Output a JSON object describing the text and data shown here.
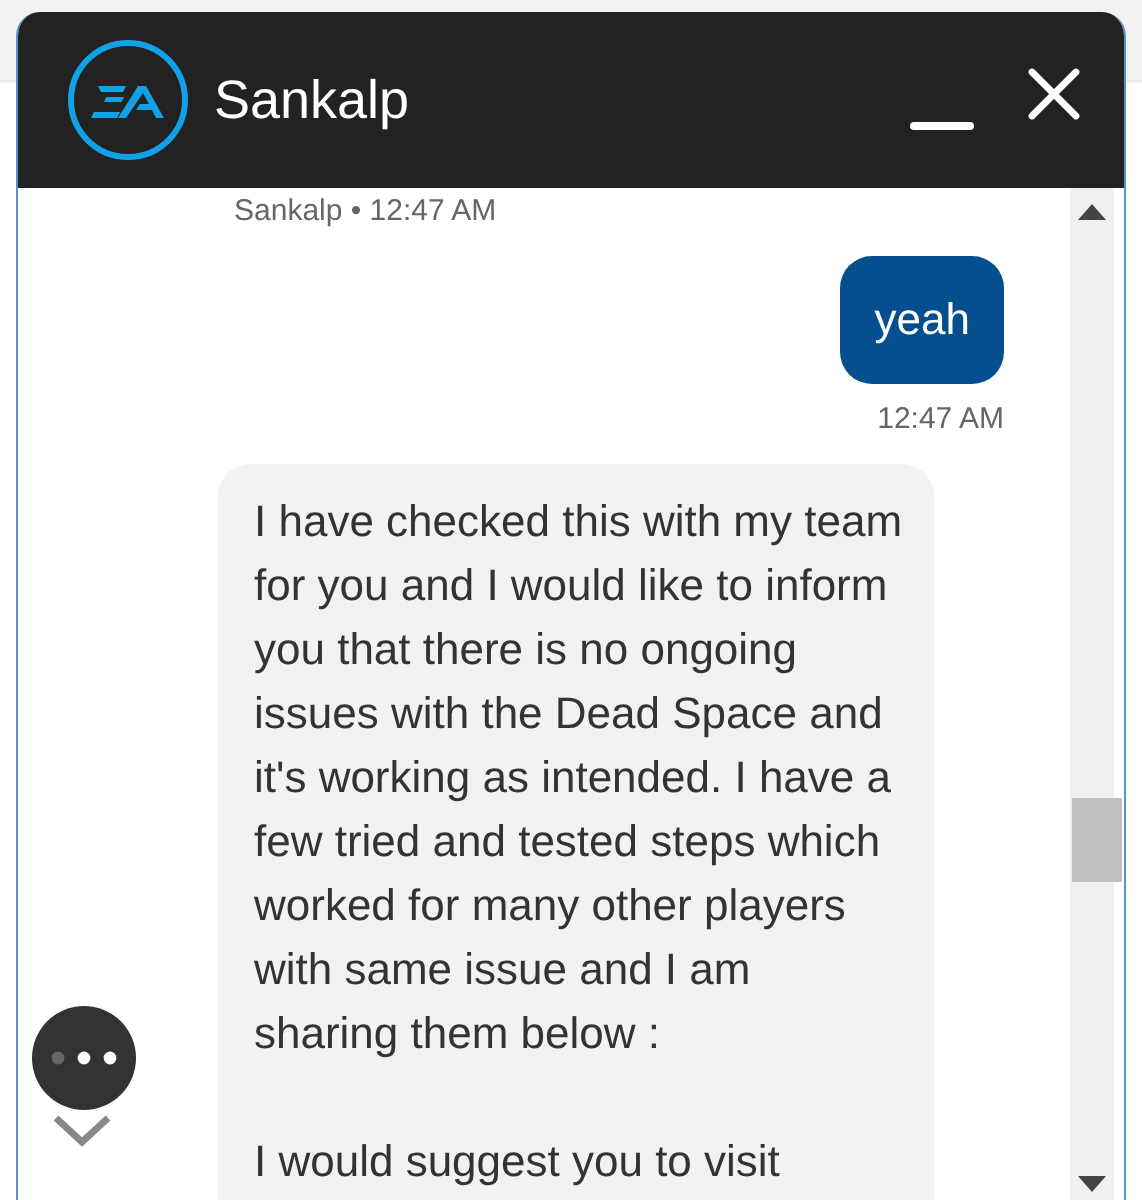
{
  "window": {
    "title": "Sankalp"
  },
  "messages": [
    {
      "kind": "meta",
      "text": "Sankalp • 12:47 AM"
    },
    {
      "kind": "sent",
      "text": "yeah"
    },
    {
      "kind": "time",
      "text": "12:47 AM"
    },
    {
      "kind": "received",
      "text": "I have checked this with my team for you and I would like to inform you that there is no ongoing issues with the Dead Space and it's working as intended. I have a few tried and tested steps which worked for many other players with same issue and I am sharing them below :\n\nI would suggest you to visit"
    }
  ]
}
